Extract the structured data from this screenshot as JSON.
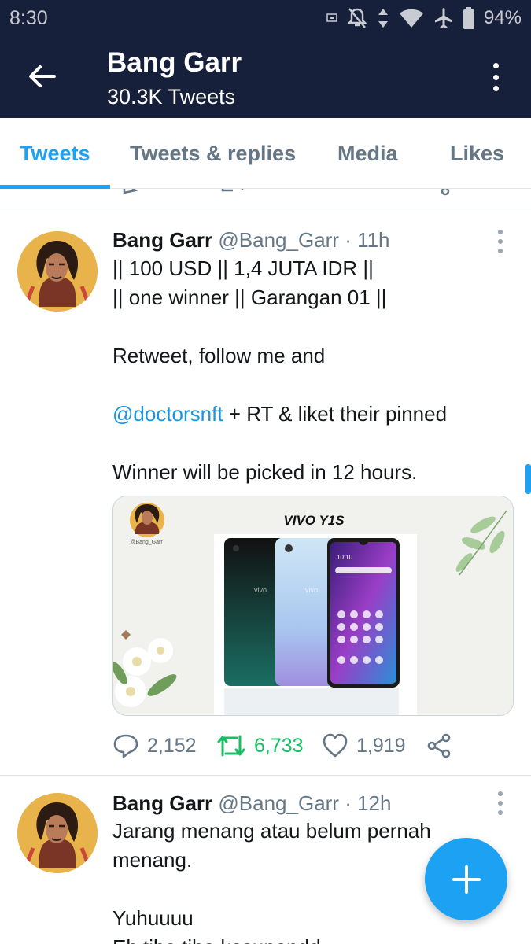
{
  "status_bar": {
    "time": "8:30",
    "battery": "94%"
  },
  "app_bar": {
    "title": "Bang Garr",
    "subtitle": "30.3K Tweets"
  },
  "tabs": [
    {
      "label": "Tweets",
      "active": true
    },
    {
      "label": "Tweets & replies",
      "active": false
    },
    {
      "label": "Media",
      "active": false
    },
    {
      "label": "Likes",
      "active": false
    }
  ],
  "tweets": [
    {
      "name": "Bang Garr",
      "meta": "@Bang_Garr · 11h",
      "lines": [
        "|| 100 USD || 1,4 JUTA IDR ||",
        "|| one winner || Garangan 01 ||",
        "",
        "Retweet, follow me and",
        "",
        "+ RT & liket their pinned",
        "",
        "Winner will be picked in 12 hours."
      ],
      "mention": "@doctorsnft",
      "media": {
        "title": "VIVO Y1S",
        "watermark": "@Bang_Garr",
        "phone_brand": "vivo",
        "clock": "10:10"
      },
      "replies": "2,152",
      "retweets": "6,733",
      "likes": "1,919"
    },
    {
      "name": "Bang Garr",
      "meta": "@Bang_Garr · 12h",
      "lines": [
        "Jarang menang atau belum pernah",
        "menang.",
        "",
        "Yuhuuuu",
        "Eh tiba tiba kesupendd"
      ]
    }
  ],
  "colors": {
    "header_bg": "#17203a",
    "accent": "#1da1f2",
    "retweet": "#17bf63",
    "muted": "#657786"
  }
}
